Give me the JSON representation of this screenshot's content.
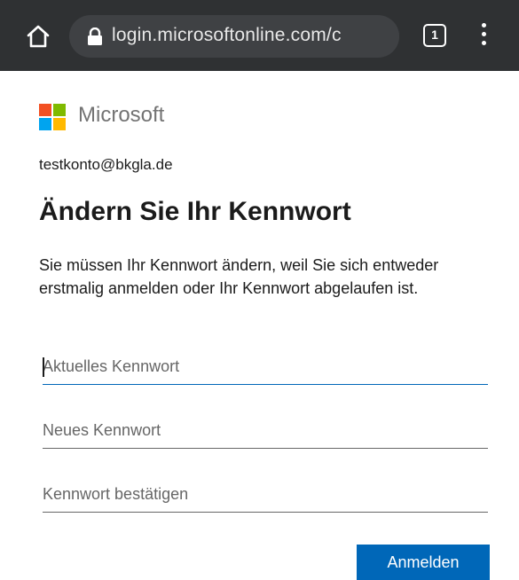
{
  "browser": {
    "url": "login.microsoftonline.com/c",
    "tab_count": "1",
    "icons": [
      "home-icon",
      "lock-icon",
      "tabs-icon",
      "more-vert-icon"
    ]
  },
  "page": {
    "brand": "Microsoft",
    "brand_colors": [
      "#f25022",
      "#7fba00",
      "#00a4ef",
      "#ffb900"
    ],
    "identity": "testkonto@bkgla.de",
    "title": "Ändern Sie Ihr Kennwort",
    "description": "Sie müssen Ihr Kennwort ändern, weil Sie sich entweder erstmalig anmelden oder Ihr Kennwort abgelaufen ist.",
    "fields": [
      {
        "placeholder": "Aktuelles Kennwort",
        "value": ""
      },
      {
        "placeholder": "Neues Kennwort",
        "value": ""
      },
      {
        "placeholder": "Kennwort bestätigen",
        "value": ""
      }
    ],
    "submit_label": "Anmelden",
    "accent": "#0067b8"
  }
}
